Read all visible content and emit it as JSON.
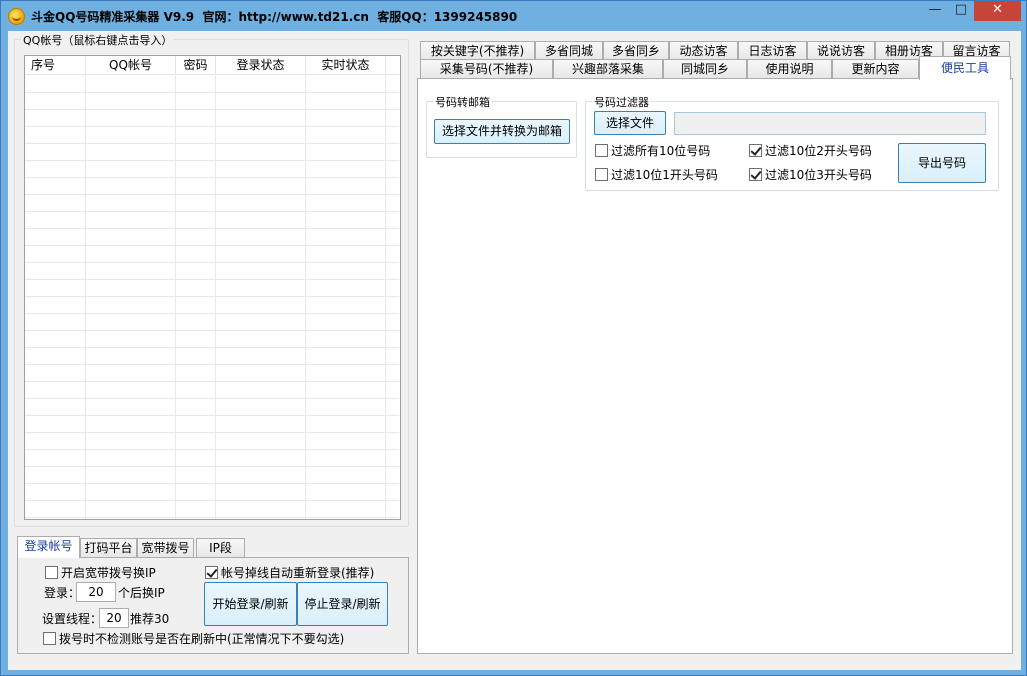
{
  "window": {
    "title": "斗金QQ号码精准采集器 V9.9  官网：http://www.td21.cn  客服QQ：1399245890",
    "minimize": "—",
    "maximize": "□",
    "close": "✕"
  },
  "accounts_group": {
    "legend": "QQ帐号（鼠标右键点击导入）",
    "columns": [
      "序号",
      "QQ帐号",
      "密码",
      "登录状态",
      "实时状态"
    ]
  },
  "bottom_tabs": [
    "登录帐号",
    "打码平台",
    "宽带拨号",
    "IP段"
  ],
  "login_panel": {
    "broadband_ip": "开启宽带拨号换IP",
    "auto_relogin": "帐号掉线自动重新登录(推荐)",
    "login_prefix": "登录：",
    "login_count": "20",
    "login_suffix": "个后换IP",
    "threads_label": "设置线程：",
    "threads_value": "20",
    "threads_hint": "推荐30",
    "start_button": "开始登录/刷新",
    "stop_button": "停止登录/刷新",
    "no_check": "拨号时不检测账号是否在刷新中(正常情况下不要勾选)"
  },
  "top_tabs_row1": [
    "按关键字(不推荐)",
    "多省同城",
    "多省同乡",
    "动态访客",
    "日志访客",
    "说说访客",
    "相册访客",
    "留言访客"
  ],
  "top_tabs_row2": [
    "采集号码(不推荐)",
    "兴趣部落采集",
    "同城同乡",
    "使用说明",
    "更新内容",
    "便民工具"
  ],
  "tools": {
    "mail_group_legend": "号码转邮箱",
    "mail_button": "选择文件并转换为邮箱",
    "filter_group_legend": "号码过滤器",
    "choose_file": "选择文件",
    "file_path": "",
    "filter_all10": "过滤所有10位号码",
    "filter_10_1": "过滤10位1开头号码",
    "filter_10_2": "过滤10位2开头号码",
    "filter_10_3": "过滤10位3开头号码",
    "export_button": "导出号码"
  }
}
